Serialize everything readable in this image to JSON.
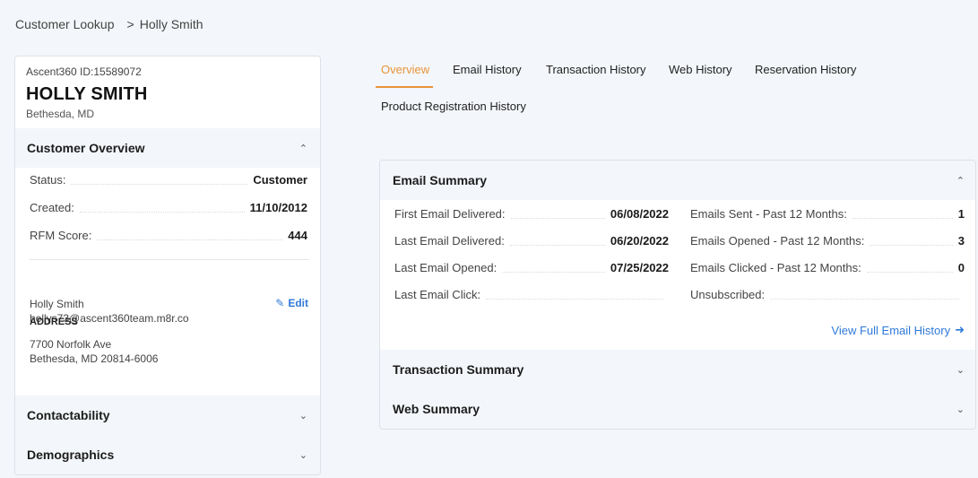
{
  "breadcrumb": {
    "root": "Customer Lookup",
    "sep": ">",
    "current": "Holly Smith"
  },
  "customer": {
    "id_label": "Ascent360 ID:15589072",
    "name": "HOLLY SMITH",
    "location": "Bethesda, MD"
  },
  "overview": {
    "title": "Customer Overview",
    "rows": [
      {
        "label": "Status:",
        "value": "Customer"
      },
      {
        "label": "Created:",
        "value": "11/10/2012"
      },
      {
        "label": "RFM Score:",
        "value": "444"
      }
    ],
    "contact_name": "Holly Smith",
    "contact_email": "hollys73@ascent360team.m8r.co",
    "edit_label": "Edit",
    "address_label": "ADDRESS",
    "address_line1": "7700 Norfolk Ave",
    "address_line2": "Bethesda, MD 20814-6006"
  },
  "contactability": {
    "title": "Contactability"
  },
  "demographics": {
    "title": "Demographics"
  },
  "tabs": [
    {
      "label": "Overview",
      "active": true
    },
    {
      "label": "Email History"
    },
    {
      "label": "Transaction History"
    },
    {
      "label": "Web History"
    },
    {
      "label": "Reservation History"
    },
    {
      "label": "Product Registration History"
    }
  ],
  "email_summary": {
    "title": "Email Summary",
    "left": [
      {
        "label": "First Email Delivered:",
        "value": "06/08/2022"
      },
      {
        "label": "Last Email Delivered:",
        "value": "06/20/2022"
      },
      {
        "label": "Last Email Opened:",
        "value": "07/25/2022"
      },
      {
        "label": "Last Email Click:",
        "value": ""
      }
    ],
    "right": [
      {
        "label": "Emails Sent - Past 12 Months:",
        "value": "1"
      },
      {
        "label": "Emails Opened - Past 12 Months:",
        "value": "3"
      },
      {
        "label": "Emails Clicked - Past 12 Months:",
        "value": "0"
      },
      {
        "label": "Unsubscribed:",
        "value": ""
      }
    ],
    "view_full": "View Full Email History"
  },
  "transaction_summary": {
    "title": "Transaction Summary"
  },
  "web_summary": {
    "title": "Web Summary"
  },
  "colors": {
    "accent": "#e8953a",
    "link": "#2f7ad8",
    "background": "#f3f6fa"
  }
}
